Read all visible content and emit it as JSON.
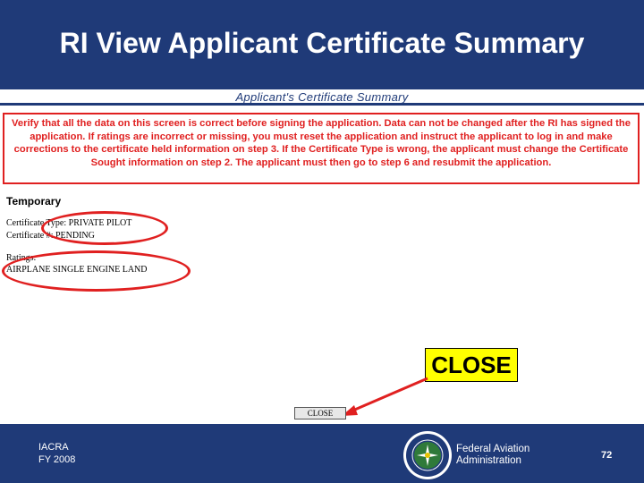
{
  "slide": {
    "title": "RI View Applicant Certificate Summary"
  },
  "screen": {
    "title": "Applicant's Certificate Summary",
    "warning": "Verify that all the data on this screen is correct before signing the application. Data can not be changed after the RI has signed the application. If ratings are incorrect or missing, you must reset the application and instruct the applicant to log in and make corrections to the certificate held information on step 3. If the Certificate Type is wrong, the applicant must change the Certificate Sought information on step 2. The applicant must then go to step 6 and resubmit the application.",
    "section_heading": "Temporary",
    "certificate_type": "Certificate Type: PRIVATE PILOT",
    "certificate_number": "Certificate #: PENDING",
    "ratings_label": "Ratings:",
    "rating_value": "AIRPLANE SINGLE ENGINE LAND",
    "close_button_label": "CLOSE"
  },
  "callout": {
    "label": "CLOSE"
  },
  "footer": {
    "left_line1": "IACRA",
    "left_line2": "FY 2008",
    "org_line1": "Federal Aviation",
    "org_line2": "Administration",
    "page_number": "72"
  },
  "colors": {
    "header_bg": "#1f3a78",
    "warning_red": "#e02020",
    "callout_yellow": "#ffff00"
  }
}
